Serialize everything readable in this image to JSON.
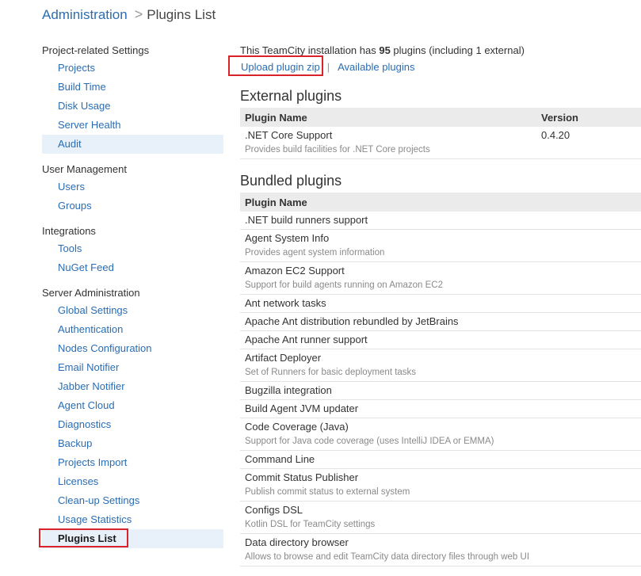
{
  "breadcrumb": {
    "root": "Administration",
    "separator": ">",
    "current": "Plugins List"
  },
  "sidebar": {
    "groups": [
      {
        "title": "Project-related Settings",
        "items": [
          "Projects",
          "Build Time",
          "Disk Usage",
          "Server Health",
          "Audit"
        ]
      },
      {
        "title": "User Management",
        "items": [
          "Users",
          "Groups"
        ]
      },
      {
        "title": "Integrations",
        "items": [
          "Tools",
          "NuGet Feed"
        ]
      },
      {
        "title": "Server Administration",
        "items": [
          "Global Settings",
          "Authentication",
          "Nodes Configuration",
          "Email Notifier",
          "Jabber Notifier",
          "Agent Cloud",
          "Diagnostics",
          "Backup",
          "Projects Import",
          "Licenses",
          "Clean-up Settings",
          "Usage Statistics",
          "Plugins List"
        ]
      }
    ]
  },
  "summary": {
    "prefix": "This TeamCity installation has ",
    "count": "95",
    "suffix": " plugins (including 1 external)"
  },
  "links": {
    "upload": "Upload plugin zip",
    "separator": "|",
    "available": "Available plugins"
  },
  "external": {
    "title": "External plugins",
    "col_name": "Plugin Name",
    "col_version": "Version",
    "rows": [
      {
        "name": ".NET Core Support",
        "desc": "Provides build facilities for .NET Core projects",
        "version": "0.4.20"
      }
    ]
  },
  "bundled": {
    "title": "Bundled plugins",
    "col_name": "Plugin Name",
    "rows": [
      {
        "name": ".NET build runners support",
        "desc": ""
      },
      {
        "name": "Agent System Info",
        "desc": "Provides agent system information"
      },
      {
        "name": "Amazon EC2 Support",
        "desc": "Support for build agents running on Amazon EC2"
      },
      {
        "name": "Ant network tasks",
        "desc": ""
      },
      {
        "name": "Apache Ant distribution rebundled by JetBrains",
        "desc": ""
      },
      {
        "name": "Apache Ant runner support",
        "desc": ""
      },
      {
        "name": "Artifact Deployer",
        "desc": "Set of Runners for basic deployment tasks"
      },
      {
        "name": "Bugzilla integration",
        "desc": ""
      },
      {
        "name": "Build Agent JVM updater",
        "desc": ""
      },
      {
        "name": "Code Coverage (Java)",
        "desc": "Support for Java code coverage (uses IntelliJ IDEA or EMMA)"
      },
      {
        "name": "Command Line",
        "desc": ""
      },
      {
        "name": "Commit Status Publisher",
        "desc": "Publish commit status to external system"
      },
      {
        "name": "Configs DSL",
        "desc": "Kotlin DSL for TeamCity settings"
      },
      {
        "name": "Data directory browser",
        "desc": "Allows to browse and edit TeamCity data directory files through web UI"
      }
    ]
  }
}
